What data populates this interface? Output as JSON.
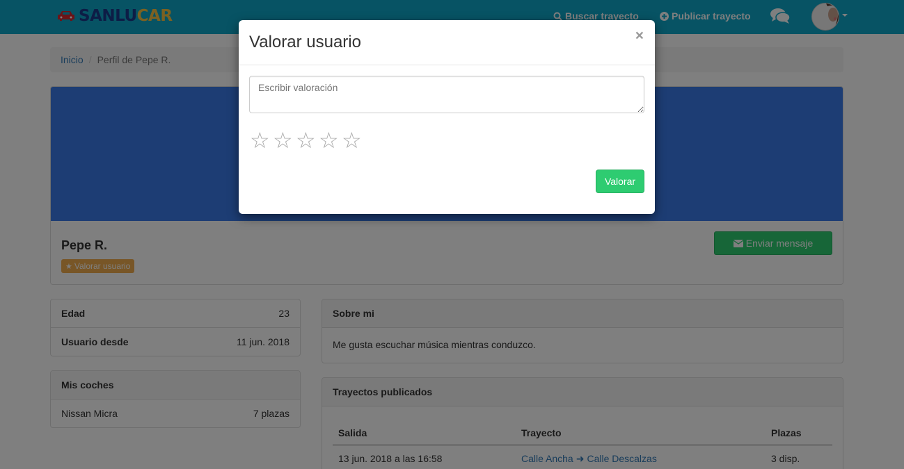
{
  "navbar": {
    "brand_part1": "SANLU",
    "brand_part2": "CAR",
    "search_label": "Buscar trayecto",
    "publish_label": "Publicar trayecto",
    "bg_color": "#0fa7c8"
  },
  "breadcrumb": {
    "home": "Inicio",
    "current": "Perfil de Pepe R."
  },
  "profile": {
    "name": "Pepe R.",
    "rate_badge": "Valorar usuario",
    "message_button": "Enviar mensaje",
    "cover_color": "#3b7be8"
  },
  "info": {
    "rows": [
      {
        "label": "Edad",
        "value": "23"
      },
      {
        "label": "Usuario desde",
        "value": "11 jun. 2018"
      }
    ]
  },
  "cars": {
    "heading": "Mis coches",
    "rows": [
      {
        "label": "Nissan Micra",
        "value": "7 plazas"
      }
    ]
  },
  "about": {
    "heading": "Sobre mi",
    "text": "Me gusta escuchar música mientras conduzco."
  },
  "trips": {
    "heading": "Trayectos publicados",
    "columns": [
      "Salida",
      "Trayecto",
      "Plazas"
    ],
    "rows": [
      {
        "departure": "13 jun. 2018 a las 16:58",
        "from": "Calle Ancha",
        "to": "Calle Descalzas",
        "seats": "3 disp."
      }
    ]
  },
  "modal": {
    "title": "Valorar usuario",
    "close": "×",
    "placeholder": "Escribir valoración",
    "stars": [
      "☆",
      "☆",
      "☆",
      "☆",
      "☆"
    ],
    "submit": "Valorar"
  }
}
